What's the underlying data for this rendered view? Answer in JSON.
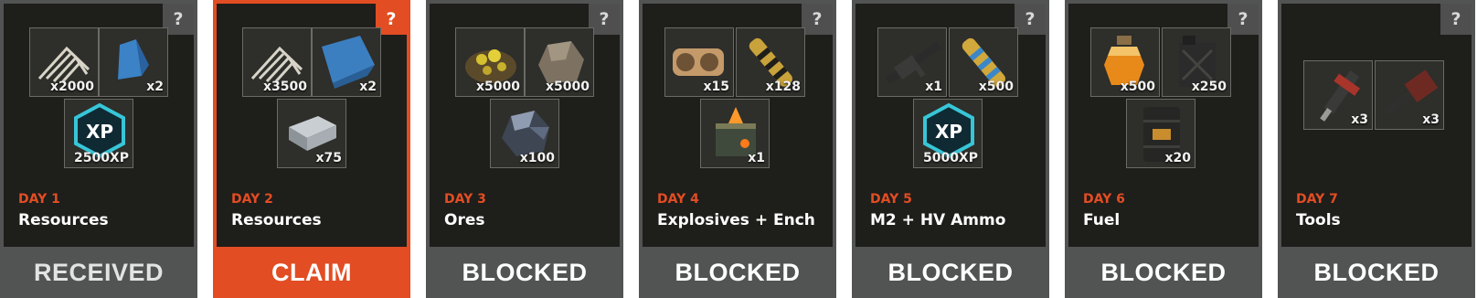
{
  "help_glyph": "?",
  "days": [
    {
      "day": "DAY 1",
      "title": "Resources",
      "status": "RECEIVED",
      "items": [
        {
          "icon": "bone-fragments-icon",
          "qty": "x2000"
        },
        {
          "icon": "blue-cloth-icon",
          "qty": "x2"
        },
        {
          "icon": "xp-badge-icon",
          "qty": "2500XP"
        }
      ]
    },
    {
      "day": "DAY 2",
      "title": "Resources",
      "status": "CLAIM",
      "items": [
        {
          "icon": "bone-fragments-icon",
          "qty": "x3500"
        },
        {
          "icon": "blue-cloth-icon",
          "qty": "x2"
        },
        {
          "icon": "metal-ingots-icon",
          "qty": "x75"
        }
      ]
    },
    {
      "day": "DAY 3",
      "title": "Ores",
      "status": "BLOCKED",
      "items": [
        {
          "icon": "sulfur-ore-icon",
          "qty": "x5000"
        },
        {
          "icon": "stone-ore-icon",
          "qty": "x5000"
        },
        {
          "icon": "metal-ore-icon",
          "qty": "x100"
        }
      ]
    },
    {
      "day": "DAY 4",
      "title": "Explosives + Ench",
      "status": "BLOCKED",
      "items": [
        {
          "icon": "explosive-charge-icon",
          "qty": "x15"
        },
        {
          "icon": "rocket-ammo-icon",
          "qty": "x128"
        },
        {
          "icon": "enchanted-crate-icon",
          "qty": "x1"
        }
      ]
    },
    {
      "day": "DAY 5",
      "title": "M2 + HV Ammo",
      "status": "BLOCKED",
      "items": [
        {
          "icon": "machine-gun-icon",
          "qty": "x1"
        },
        {
          "icon": "hv-ammo-icon",
          "qty": "x500"
        },
        {
          "icon": "xp-badge-icon",
          "qty": "5000XP"
        }
      ]
    },
    {
      "day": "DAY 6",
      "title": "Fuel",
      "status": "BLOCKED",
      "items": [
        {
          "icon": "fuel-jar-icon",
          "qty": "x500"
        },
        {
          "icon": "jerry-can-icon",
          "qty": "x250"
        },
        {
          "icon": "oil-barrel-icon",
          "qty": "x20"
        }
      ]
    },
    {
      "day": "DAY 7",
      "title": "Tools",
      "status": "BLOCKED",
      "items": [
        {
          "icon": "jackhammer-icon",
          "qty": "x3"
        },
        {
          "icon": "chainsaw-icon",
          "qty": "x3"
        }
      ]
    }
  ]
}
